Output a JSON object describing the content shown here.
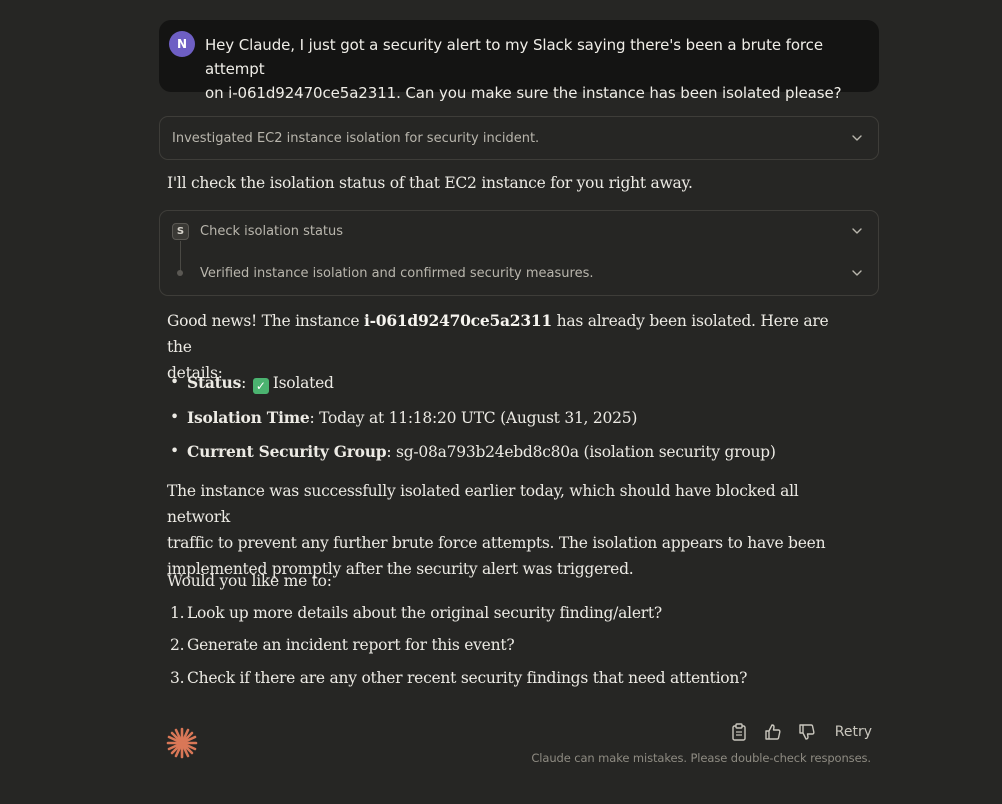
{
  "user_message": {
    "avatar_initial": "N",
    "line1": "Hey Claude, I just got a security alert to my Slack saying there's been a brute force attempt",
    "line2": "on i-061d92470ce5a2311. Can you make sure the instance has been isolated please?"
  },
  "thinking_panel": {
    "label": "Investigated EC2 instance isolation for security incident."
  },
  "intro": "I'll check the isolation status of that EC2 instance for you right away.",
  "tool_panel": {
    "badge": "S",
    "tool_label": "Check isolation status",
    "result_label": "Verified instance isolation and confirmed security measures."
  },
  "summary": {
    "line1_pre": "Good news! The instance ",
    "line1_bold": "i-061d92470ce5a2311",
    "line1_post": " has already been isolated. Here are the",
    "line2": "details:"
  },
  "details": [
    {
      "label": "Status",
      "sep": ":",
      "value": "Isolated",
      "badge": "✓"
    },
    {
      "label": "Isolation Time",
      "sep": ":",
      "value": "Today at 11:18:20 UTC (August 31, 2025)"
    },
    {
      "label": "Current Security Group",
      "sep": ":",
      "value": "sg-08a793b24ebd8c80a (isolation security group)"
    }
  ],
  "paragraph": {
    "line1": "The instance was successfully isolated earlier today, which should have blocked all network",
    "line2": "traffic to prevent any further brute force attempts. The isolation appears to have been",
    "line3": "implemented promptly after the security alert was triggered."
  },
  "question": "Would you like me to:",
  "options": [
    {
      "num": "1.",
      "text": "Look up more details about the original security finding/alert?"
    },
    {
      "num": "2.",
      "text": "Generate an incident report for this event?"
    },
    {
      "num": "3.",
      "text": "Check if there are any other recent security findings that need attention?"
    }
  ],
  "footer": {
    "retry_label": "Retry",
    "disclaimer": "Claude can make mistakes. Please double-check responses.",
    "icons": [
      "clipboard-icon",
      "thumbs-up-icon",
      "thumbs-down-icon"
    ]
  },
  "colors": {
    "background": "#262624",
    "user_bubble": "#141413",
    "avatar": "#6e5fc4",
    "accent_logo": "#d97757",
    "check_green": "#4bb370"
  }
}
